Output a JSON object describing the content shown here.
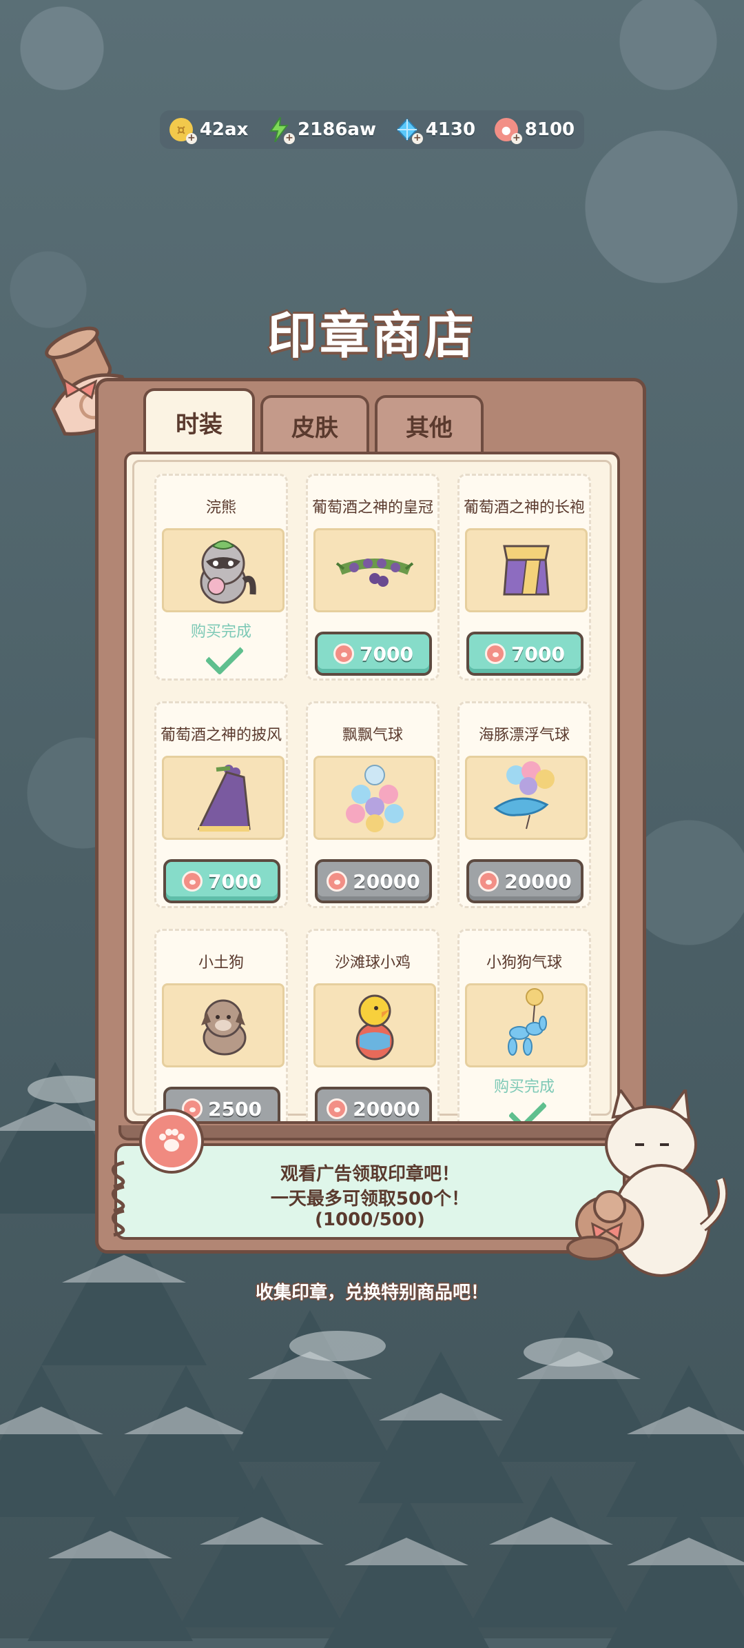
{
  "currencies": [
    {
      "icon": "gold-coin-icon",
      "value": "42ax",
      "color": "#f2c94c"
    },
    {
      "icon": "lightning-icon",
      "value": "2186aw",
      "color": "#7ed957"
    },
    {
      "icon": "diamond-icon",
      "value": "4130",
      "color": "#5ac8fa"
    },
    {
      "icon": "paw-stamp-icon",
      "value": "8100",
      "color": "#f28f86"
    }
  ],
  "title": "印章商店",
  "tabs": [
    {
      "label": "时装",
      "active": true
    },
    {
      "label": "皮肤",
      "active": false
    },
    {
      "label": "其他",
      "active": false
    }
  ],
  "items": [
    {
      "name": "浣熊",
      "icon": "raccoon-icon",
      "status": "购买完成",
      "purchased": true
    },
    {
      "name": "葡萄酒之神的皇冠",
      "icon": "grape-crown-icon",
      "price": "7000",
      "style": "green"
    },
    {
      "name": "葡萄酒之神的长袍",
      "icon": "robe-icon",
      "price": "7000",
      "style": "green"
    },
    {
      "name": "葡萄酒之神的披风",
      "icon": "cape-icon",
      "price": "7000",
      "style": "green"
    },
    {
      "name": "飘飘气球",
      "icon": "balloons-icon",
      "price": "20000",
      "style": "gray"
    },
    {
      "name": "海豚漂浮气球",
      "icon": "dolphin-balloon-icon",
      "price": "20000",
      "style": "gray"
    },
    {
      "name": "小土狗",
      "icon": "puppy-icon",
      "price": "2500",
      "style": "gray"
    },
    {
      "name": "沙滩球小鸡",
      "icon": "chick-beachball-icon",
      "price": "20000",
      "style": "gray"
    },
    {
      "name": "小狗狗气球",
      "icon": "dog-balloon-icon",
      "status": "购买完成",
      "purchased": true
    }
  ],
  "ad": {
    "line1": "观看广告领取印章吧！",
    "line2": "一天最多可领取500个！",
    "line3": "(1000/500)"
  },
  "footer": "收集印章，兑换特别商品吧！",
  "colors": {
    "accent_green": "#86dcc9",
    "panel_brown": "#b28674",
    "stamp_pink": "#f08a80"
  }
}
